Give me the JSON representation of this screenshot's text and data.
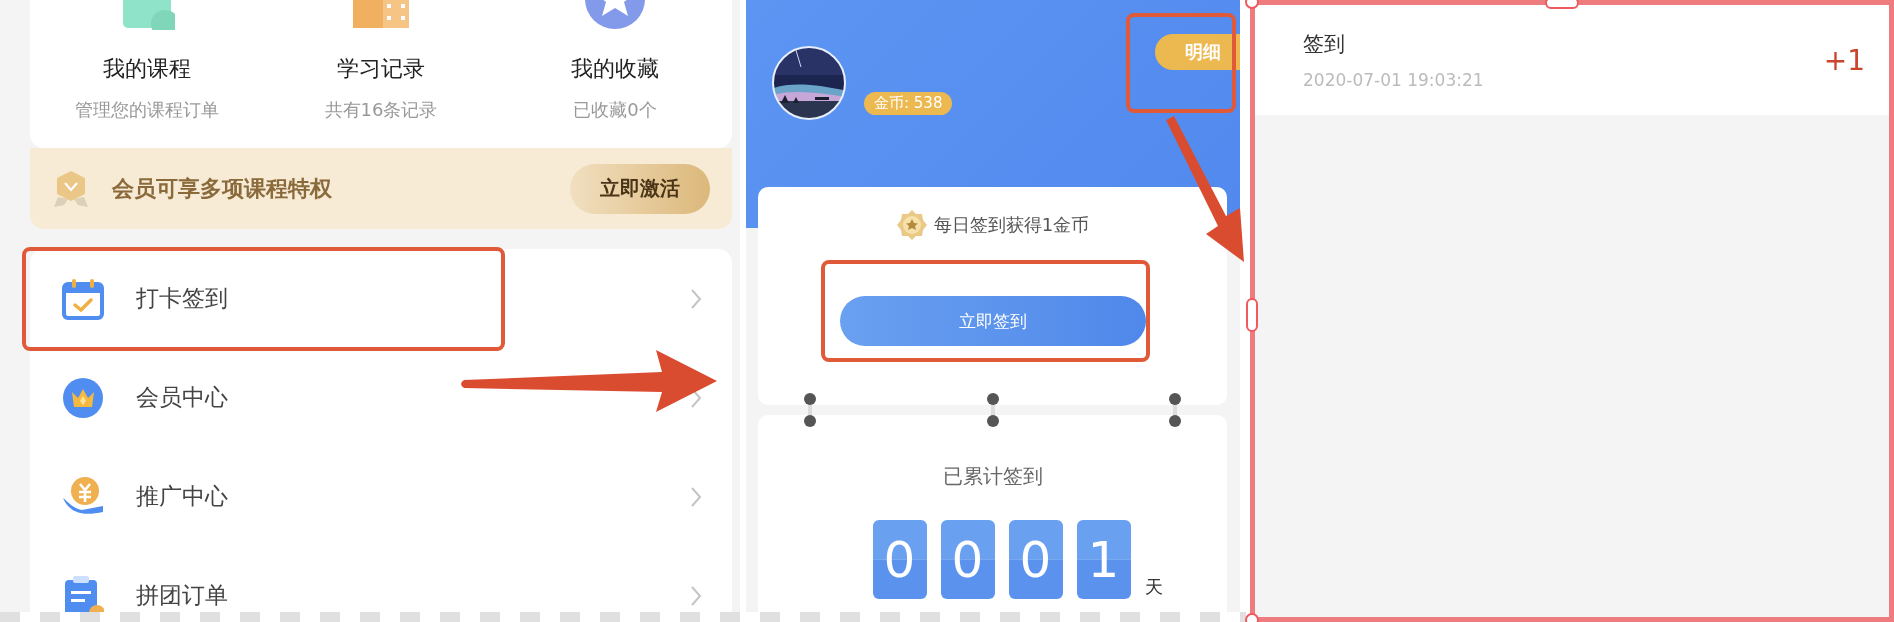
{
  "course_card": {
    "items": [
      {
        "kind": "book",
        "title": "我的课程",
        "subtitle": "管理您的课程订单"
      },
      {
        "kind": "video",
        "title": "学习记录",
        "subtitle": "共有16条记录"
      },
      {
        "kind": "star",
        "title": "我的收藏",
        "subtitle": "已收藏0个"
      }
    ]
  },
  "member_banner": {
    "text": "会员可享多项课程特权",
    "button": "立即激活"
  },
  "menu": [
    {
      "kind": "calendar",
      "label": "打卡签到",
      "highlighted": true
    },
    {
      "kind": "crown",
      "label": "会员中心",
      "highlighted": false
    },
    {
      "kind": "coin",
      "label": "推广中心",
      "highlighted": false
    },
    {
      "kind": "clipboard",
      "label": "拼团订单",
      "highlighted": false
    }
  ],
  "checkin": {
    "coins": "金币: 538",
    "detail_button": {
      "label": "明细",
      "highlighted": true
    },
    "reward_text": "每日签到获得1金币",
    "checkin_button": {
      "label": "立即签到",
      "highlighted": true
    },
    "total_label": "已累计签到",
    "digits": [
      "0",
      "0",
      "0",
      "1"
    ],
    "unit": "天"
  },
  "records": [
    {
      "title": "签到",
      "time": "2020-07-01 19:03:21",
      "amount": "+1"
    }
  ]
}
